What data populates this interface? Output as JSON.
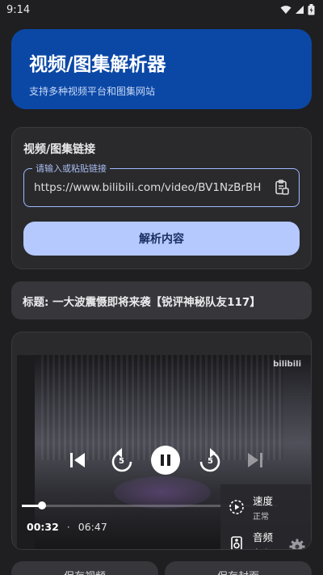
{
  "status_bar": {
    "time": "9:14",
    "icons": [
      "wifi-icon",
      "signal-icon",
      "battery-icon"
    ]
  },
  "hero": {
    "title": "视频/图集解析器",
    "subtitle": "支持多种视频平台和图集网站"
  },
  "link_card": {
    "label": "视频/图集链接",
    "input_legend": "请输入或粘贴链接",
    "input_value": "https://www.bilibili.com/video/BV1NzBrBH",
    "paste_icon": "paste-icon",
    "parse_button": "解析内容"
  },
  "title_card": {
    "text": "标题: 一大波震慑即将来袭【锐评神秘队友117】"
  },
  "player": {
    "watermark": "bilibili",
    "current_time": "00:32",
    "separator": "·",
    "duration": "06:47",
    "progress": 0.08,
    "rewind_seconds": "5",
    "forward_seconds": "5",
    "menu": [
      {
        "title": "速度",
        "value": "正常",
        "icon": "speed-icon"
      },
      {
        "title": "音频",
        "value": "自动",
        "icon": "audio-track-icon"
      }
    ]
  },
  "bottom_buttons": {
    "left": "保存视频",
    "right": "保存封面"
  },
  "colors": {
    "accent": "#0b48a6",
    "button": "#b6c9ff",
    "border": "#9fb9ff"
  }
}
